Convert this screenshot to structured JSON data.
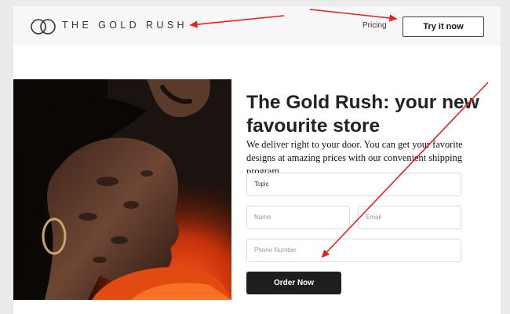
{
  "header": {
    "brand": "THE GOLD RUSH",
    "nav_pricing": "Pricing",
    "cta_label": "Try it now"
  },
  "hero": {
    "title": "The Gold Rush: your new favourite store",
    "description": "We deliver right to your door. You can get your favorite designs at amazing prices with our convenient shipping program."
  },
  "form": {
    "topic_value": "Topic",
    "name_placeholder": "Name",
    "email_placeholder": "Email",
    "phone_placeholder": "Phone Number",
    "submit_label": "Order Now"
  },
  "colors": {
    "header_bg": "#f7f6f9",
    "button_dark": "#1e1e1e",
    "annotation_arrow": "#e8201c"
  }
}
